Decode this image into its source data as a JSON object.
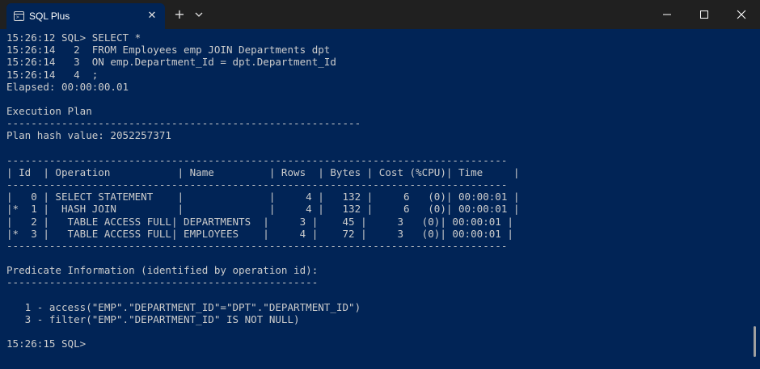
{
  "window": {
    "tab_title": "SQL Plus",
    "tab_icon": "terminal-icon",
    "controls": [
      "minimize-icon",
      "maximize-icon",
      "close-icon"
    ]
  },
  "terminal": {
    "lines": [
      "15:26:12 SQL> SELECT *",
      "15:26:14   2  FROM Employees emp JOIN Departments dpt",
      "15:26:14   3  ON emp.Department_Id = dpt.Department_Id",
      "15:26:14   4  ;",
      "Elapsed: 00:00:00.01",
      "",
      "Execution Plan",
      "----------------------------------------------------------",
      "Plan hash value: 2052257371",
      "",
      "----------------------------------------------------------------------------------",
      "| Id  | Operation           | Name         | Rows  | Bytes | Cost (%CPU)| Time     |",
      "----------------------------------------------------------------------------------",
      "|   0 | SELECT STATEMENT    |              |     4 |   132 |     6   (0)| 00:00:01 |",
      "|*  1 |  HASH JOIN          |              |     4 |   132 |     6   (0)| 00:00:01 |",
      "|   2 |   TABLE ACCESS FULL| DEPARTMENTS  |     3 |    45 |     3   (0)| 00:00:01 |",
      "|*  3 |   TABLE ACCESS FULL| EMPLOYEES    |     4 |    72 |     3   (0)| 00:00:01 |",
      "----------------------------------------------------------------------------------",
      "",
      "Predicate Information (identified by operation id):",
      "---------------------------------------------------",
      "",
      "   1 - access(\"EMP\".\"DEPARTMENT_ID\"=\"DPT\".\"DEPARTMENT_ID\")",
      "   3 - filter(\"EMP\".\"DEPARTMENT_ID\" IS NOT NULL)",
      "",
      "15:26:15 SQL>"
    ]
  },
  "colors": {
    "background": "#012456",
    "titlebar": "#202020",
    "text": "#cccccc"
  }
}
